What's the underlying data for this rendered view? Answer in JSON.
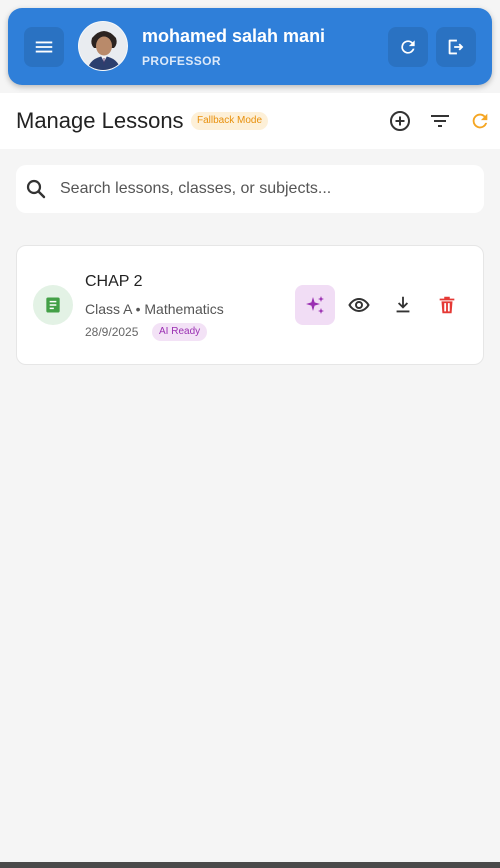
{
  "appbar": {
    "user_name": "mohamed salah mani",
    "user_role": "PROFESSOR",
    "icons": {
      "menu": "menu-icon",
      "refresh": "refresh-icon",
      "logout": "logout-icon",
      "avatar": "avatar-photo"
    }
  },
  "header": {
    "title": "Manage Lessons",
    "mode_badge": "Fallback Mode",
    "icons": {
      "add": "add-circle-icon",
      "filter": "filter-icon",
      "refresh": "refresh-icon"
    }
  },
  "search": {
    "placeholder": "Search lessons, classes, or subjects...",
    "value": ""
  },
  "lessons": [
    {
      "title": "CHAP 2",
      "meta": "Class A • Mathematics",
      "date": "28/9/2025",
      "badge": "AI Ready",
      "actions": [
        "ai-sparkle-icon",
        "view-icon",
        "download-icon",
        "delete-icon"
      ]
    }
  ],
  "colors": {
    "primary": "#2f7fd9",
    "accent_orange": "#f5a623",
    "ai_purple": "#9a2fb2",
    "delete_red": "#e53935",
    "doc_green": "#43a047"
  }
}
